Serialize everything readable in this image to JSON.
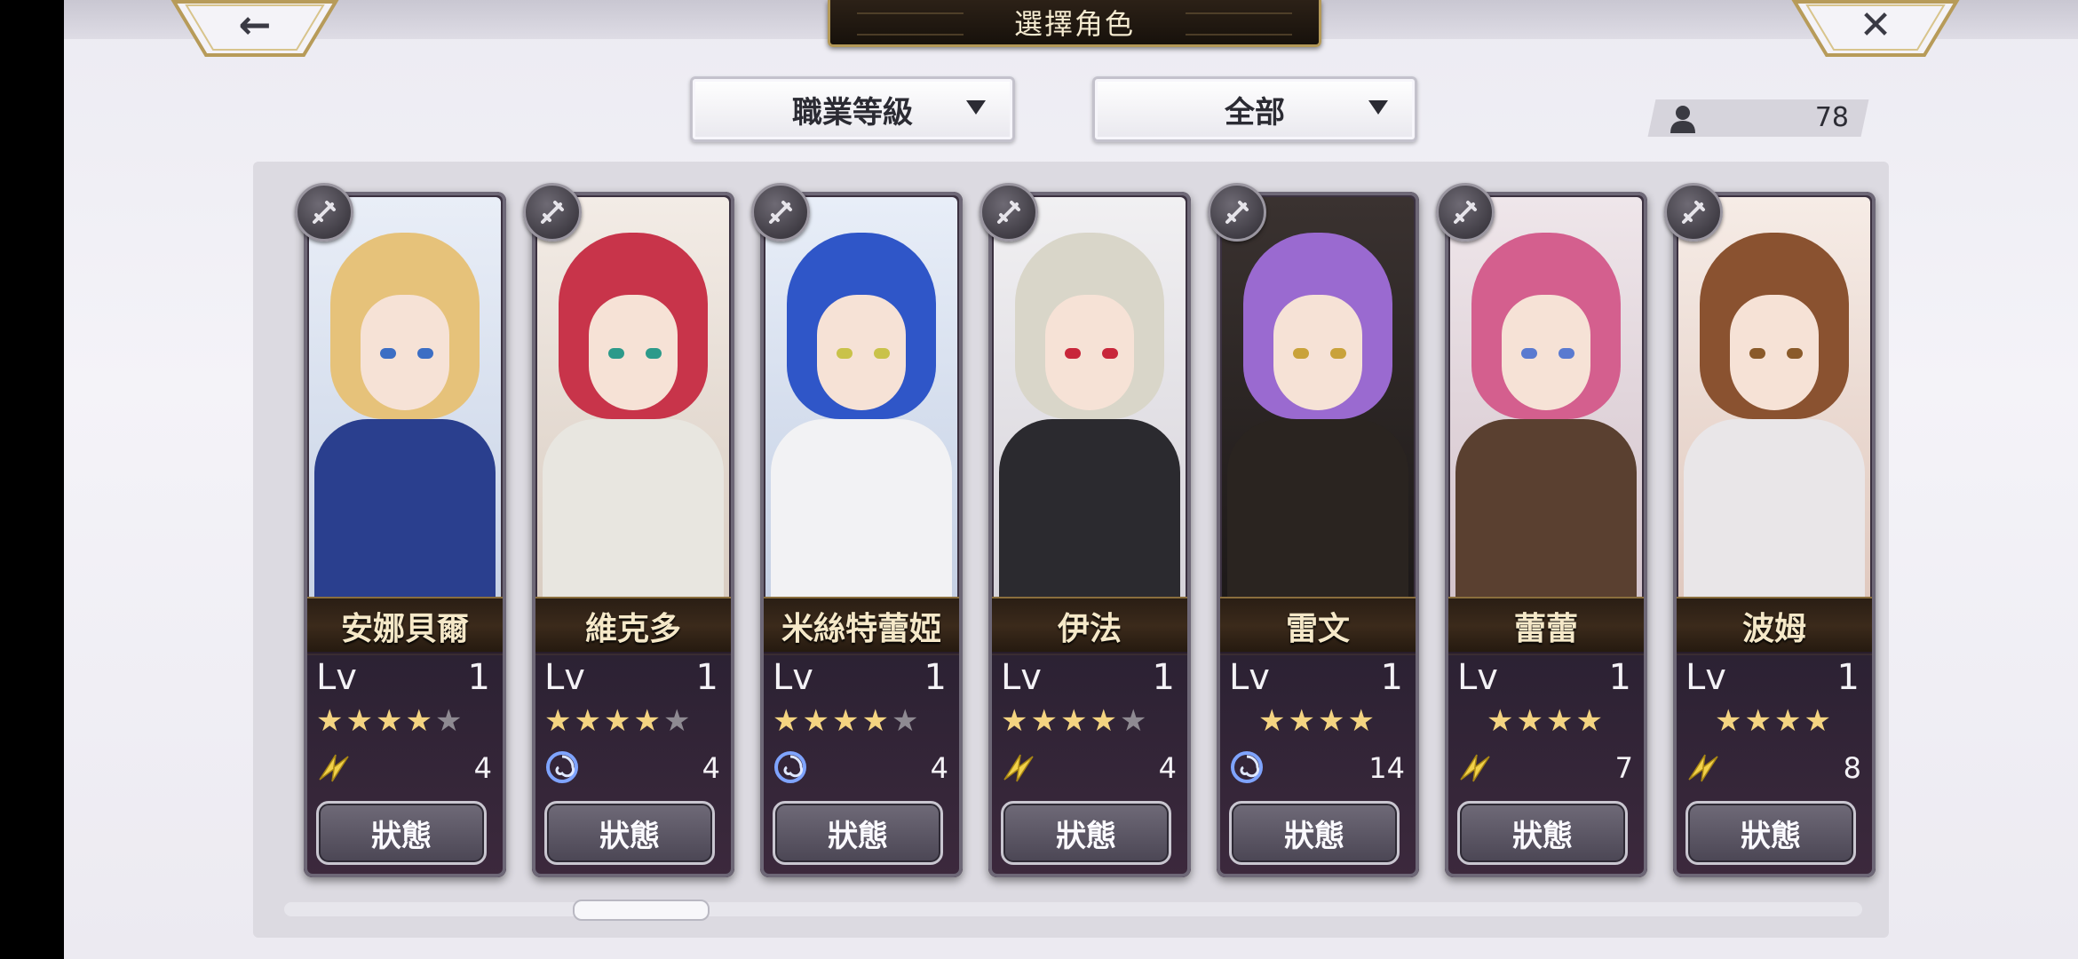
{
  "header": {
    "title": "選擇角色",
    "back_glyph": "←",
    "close_glyph": "✕"
  },
  "filters": [
    {
      "label": "職業等級"
    },
    {
      "label": "全部"
    }
  ],
  "roster_count": "78",
  "characters": [
    {
      "name": "安娜貝爾",
      "lv_label": "Lv",
      "level": "1",
      "stars": 4,
      "max_stars": 5,
      "element": "lightning-wing",
      "count": "4",
      "status": "狀態",
      "class_icon": "sword-icon"
    },
    {
      "name": "維克多",
      "lv_label": "Lv",
      "level": "1",
      "stars": 4,
      "max_stars": 5,
      "element": "wind-swirl",
      "count": "4",
      "status": "狀態",
      "class_icon": "blade-icon"
    },
    {
      "name": "米絲特蕾婭",
      "lv_label": "Lv",
      "level": "1",
      "stars": 4,
      "max_stars": 5,
      "element": "wind-swirl",
      "count": "4",
      "status": "狀態",
      "class_icon": "bow-icon"
    },
    {
      "name": "伊法",
      "lv_label": "Lv",
      "level": "1",
      "stars": 4,
      "max_stars": 5,
      "element": "lightning-wing",
      "count": "4",
      "status": "狀態",
      "class_icon": "gauntlet-icon"
    },
    {
      "name": "雷文",
      "lv_label": "Lv",
      "level": "1",
      "stars": 4,
      "max_stars": 4,
      "element": "wind-swirl",
      "count": "14",
      "status": "狀態",
      "class_icon": "staff-icon"
    },
    {
      "name": "蕾蕾",
      "lv_label": "Lv",
      "level": "1",
      "stars": 4,
      "max_stars": 4,
      "element": "lightning-wing",
      "count": "7",
      "status": "狀態",
      "class_icon": "staff-icon"
    },
    {
      "name": "波姆",
      "lv_label": "Lv",
      "level": "1",
      "stars": 4,
      "max_stars": 4,
      "element": "lightning-wing",
      "count": "8",
      "status": "狀態",
      "class_icon": "staff-icon"
    }
  ],
  "scroll_position": 0.2,
  "colors": {
    "star": "#f4d481",
    "star_dim": "#8e8a92",
    "gold_trim": "#b39857"
  }
}
